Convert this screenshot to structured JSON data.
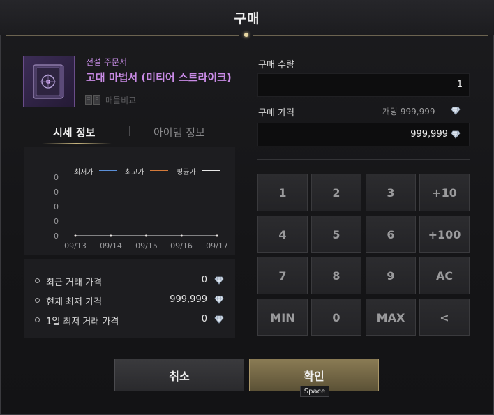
{
  "dialog": {
    "title": "구매"
  },
  "item": {
    "grade": "전설 주문서",
    "name": "고대 마법서 (미티어 스트라이크)",
    "compare_label": "매물비교"
  },
  "tabs": [
    {
      "label": "시세 정보",
      "active": true
    },
    {
      "label": "아이템 정보",
      "active": false
    }
  ],
  "chart_data": {
    "type": "line",
    "categories": [
      "09/13",
      "09/14",
      "09/15",
      "09/16",
      "09/17"
    ],
    "series": [
      {
        "name": "최저가",
        "values": [
          0,
          0,
          0,
          0,
          0
        ],
        "color": "#5b8fd8"
      },
      {
        "name": "최고가",
        "values": [
          0,
          0,
          0,
          0,
          0
        ],
        "color": "#d47a3a"
      },
      {
        "name": "평균가",
        "values": [
          0,
          0,
          0,
          0,
          0
        ],
        "color": "#e8e8e8"
      }
    ],
    "ytick_labels": [
      "0",
      "0",
      "0",
      "0",
      "0"
    ],
    "legend": "top"
  },
  "stats": [
    {
      "label": "최근 거래 가격",
      "value": "0"
    },
    {
      "label": "현재 최저 가격",
      "value": "999,999"
    },
    {
      "label": "1일 최저 거래 가격",
      "value": "0"
    }
  ],
  "purchase": {
    "quantity_label": "구매 수량",
    "quantity_value": "1",
    "price_label": "구매 가격",
    "unit_price_text": "개당 999,999",
    "price_value": "999,999"
  },
  "keypad": [
    "1",
    "2",
    "3",
    "+10",
    "4",
    "5",
    "6",
    "+100",
    "7",
    "8",
    "9",
    "AC",
    "MIN",
    "0",
    "MAX",
    "<"
  ],
  "buttons": {
    "cancel": "취소",
    "confirm": "확인",
    "confirm_hotkey": "Space"
  },
  "icons": {
    "currency": "diamond-icon",
    "item": "spellbook-icon",
    "compare": "compare-icon"
  },
  "colors": {
    "legendary": "#c98be6",
    "accent_gold": "#8a7b54",
    "series_low": "#5b8fd8",
    "series_high": "#d47a3a",
    "series_avg": "#e8e8e8"
  }
}
